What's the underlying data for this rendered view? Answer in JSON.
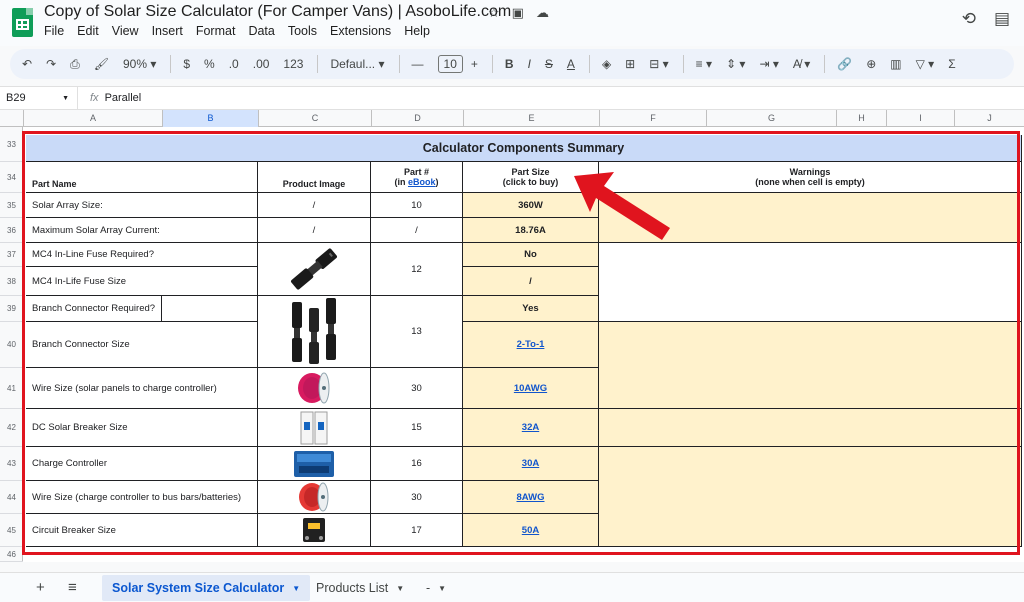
{
  "app": {
    "title": "Copy of Solar Size Calculator (For Camper Vans) | AsoboLife.com",
    "menu": [
      "File",
      "Edit",
      "View",
      "Insert",
      "Format",
      "Data",
      "Tools",
      "Extensions",
      "Help"
    ],
    "title_icons": [
      "star-icon",
      "move-to-folder-icon",
      "cloud-status-icon"
    ],
    "top_right_icons": [
      "history-icon",
      "comments-icon"
    ]
  },
  "toolbar": {
    "zoom": "90%",
    "currency": "$",
    "percent": "%",
    "decrease_decimal": ".0",
    "increase_decimal": ".00",
    "number_format": "123",
    "font": "Defaul...",
    "minus": "—",
    "font_size": "10",
    "plus": "+",
    "bold": "B",
    "italic": "I",
    "strike": "S",
    "text_color": "A",
    "sigma": "Σ"
  },
  "formula_bar": {
    "cell_ref": "B29",
    "fx": "fx",
    "value": "Parallel"
  },
  "columns": [
    "A",
    "B",
    "C",
    "D",
    "E",
    "F",
    "G",
    "H",
    "I",
    "J"
  ],
  "rows": [
    "33",
    "34",
    "35",
    "36",
    "37",
    "38",
    "39",
    "40",
    "41",
    "42",
    "43",
    "44",
    "45",
    "46"
  ],
  "sheet": {
    "banner": "Calculator Components Summary",
    "headers": {
      "part_name": "Part Name",
      "product_image": "Product Image",
      "part_num_line1": "Part #",
      "part_num_line2_pre": "(in ",
      "part_num_link": "eBook",
      "part_num_line2_post": ")",
      "part_size_line1": "Part Size",
      "part_size_line2": "(click to buy)",
      "warnings_line1": "Warnings",
      "warnings_line2": "(none when cell is empty)"
    },
    "cells": {
      "r35_name": "Solar Array Size:",
      "r35_img": "/",
      "r35_num": "10",
      "r35_size": "360W",
      "r36_name": "Maximum Solar Array Current:",
      "r36_img": "/",
      "r36_num": "/",
      "r36_size": "18.76A",
      "r37_name": "MC4 In-Line Fuse Required?",
      "r37_size": "No",
      "r37_38_num": "12",
      "r38_name": "MC4 In-Life Fuse Size",
      "r38_size": "/",
      "r39_name": "Branch Connector Required?",
      "r39_size": "Yes",
      "r39_40_num": "13",
      "r40_name": "Branch Connector Size",
      "r40_size": "2-To-1",
      "r41_name": "Wire Size (solar panels to charge controller)",
      "r41_num": "30",
      "r41_size": "10AWG",
      "r42_name": "DC Solar Breaker Size",
      "r42_num": "15",
      "r42_size": "32A",
      "r43_name": "Charge Controller",
      "r43_num": "16",
      "r43_size": "30A",
      "r44_name": "Wire Size (charge controller to bus bars/batteries)",
      "r44_num": "30",
      "r44_size": "8AWG",
      "r45_name": "Circuit Breaker Size",
      "r45_num": "17",
      "r45_size": "50A"
    }
  },
  "tabs": {
    "add": "+",
    "all_sheets": "≡",
    "items": [
      "Solar System Size Calculator",
      "Products List",
      "-"
    ],
    "dropdown": "▼"
  },
  "colors": {
    "highlight_yellow": "#fff2cc",
    "banner_blue": "#c9daf8",
    "annotation_red": "#e0141e",
    "link_blue": "#1155cc"
  }
}
